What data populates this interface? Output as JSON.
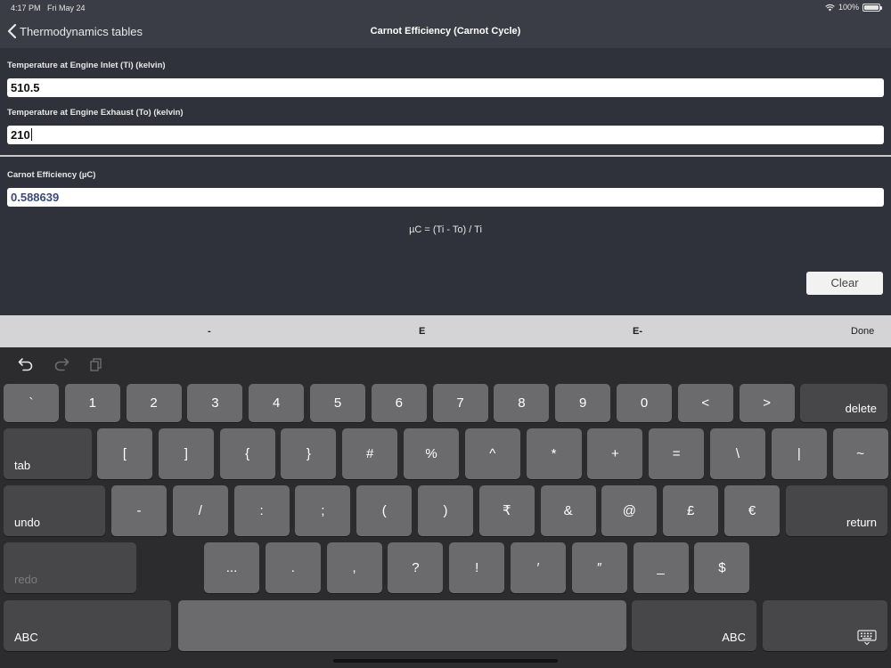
{
  "status": {
    "time": "4:17 PM",
    "date": "Fri May 24",
    "battery": "100%"
  },
  "nav": {
    "back_label": "Thermodynamics tables",
    "title": "Carnot Efficiency (Carnot Cycle)"
  },
  "form": {
    "inlet_label": "Temperature at Engine Inlet (Ti) (kelvin)",
    "inlet_value": "510.5",
    "exhaust_label": "Temperature at Engine Exhaust (To) (kelvin)",
    "exhaust_value": "210",
    "result_label": "Carnot Efficiency (µC)",
    "result_value": "0.588639",
    "formula": "µC = (Ti - To) / Ti",
    "clear_label": "Clear"
  },
  "accessory": {
    "minus": "-",
    "e": "E",
    "e_minus": "E-",
    "done": "Done"
  },
  "keyboard": {
    "undo_icon": "undo-icon",
    "redo_icon": "redo-icon",
    "paste_icon": "paste-icon",
    "hide_icon": "keyboard-hide-icon",
    "row1": [
      "`",
      "1",
      "2",
      "3",
      "4",
      "5",
      "6",
      "7",
      "8",
      "9",
      "0",
      "<",
      ">"
    ],
    "delete": "delete",
    "tab": "tab",
    "row2": [
      "[",
      "]",
      "{",
      "}",
      "#",
      "%",
      "^",
      "*",
      "+",
      "=",
      "\\",
      "|",
      "~"
    ],
    "undo": "undo",
    "row3": [
      "-",
      "/",
      ":",
      ";",
      "(",
      ")",
      "₹",
      "&",
      "@",
      "£",
      "€"
    ],
    "return": "return",
    "redo": "redo",
    "row4": [
      "...",
      ".",
      ",",
      "?",
      "!",
      "′",
      "″",
      "_",
      "$"
    ],
    "abc_left": "ABC",
    "abc_right": "ABC"
  }
}
